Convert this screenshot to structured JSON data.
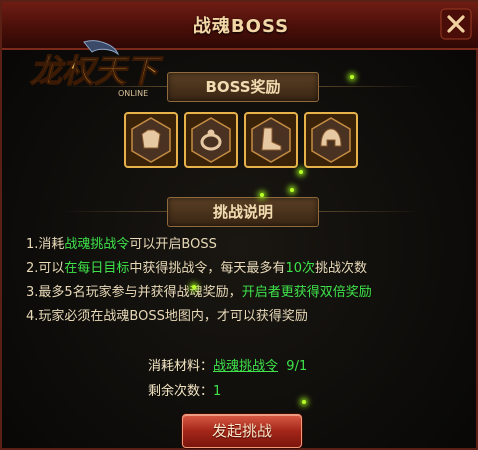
{
  "window": {
    "title": "战魂BOSS"
  },
  "logo": {
    "main_text": "龙权天下",
    "sub_text": "ONLINE"
  },
  "rewards": {
    "heading": "BOSS奖励",
    "items": [
      {
        "icon": "armor-icon"
      },
      {
        "icon": "ring-icon"
      },
      {
        "icon": "boots-icon"
      },
      {
        "icon": "helmet-icon"
      }
    ]
  },
  "rules": {
    "heading": "挑战说明",
    "line1": {
      "a": "1.消耗",
      "b": "战魂挑战令",
      "c": "可以开启BOSS"
    },
    "line2": {
      "a": "2.可以",
      "b": "在每日目标",
      "c": "中获得挑战令，每天最多有",
      "d": "10次",
      "e": "挑战次数"
    },
    "line3": {
      "a": "3.最多5名玩家参与并获得战魂奖励，",
      "b": "开启者更获得双倍奖励"
    },
    "line4": {
      "a": "4.玩家必须在战魂BOSS地图内，才可以获得奖励"
    }
  },
  "cost": {
    "label": "消耗材料：",
    "item": "战魂挑战令",
    "amount": "9/1"
  },
  "remaining": {
    "label": "剩余次数：",
    "value": "1"
  },
  "action": {
    "label": "发起挑战"
  },
  "colors": {
    "highlight": "#3ee34a",
    "text": "#e8d9b8",
    "button": "#a42619"
  }
}
